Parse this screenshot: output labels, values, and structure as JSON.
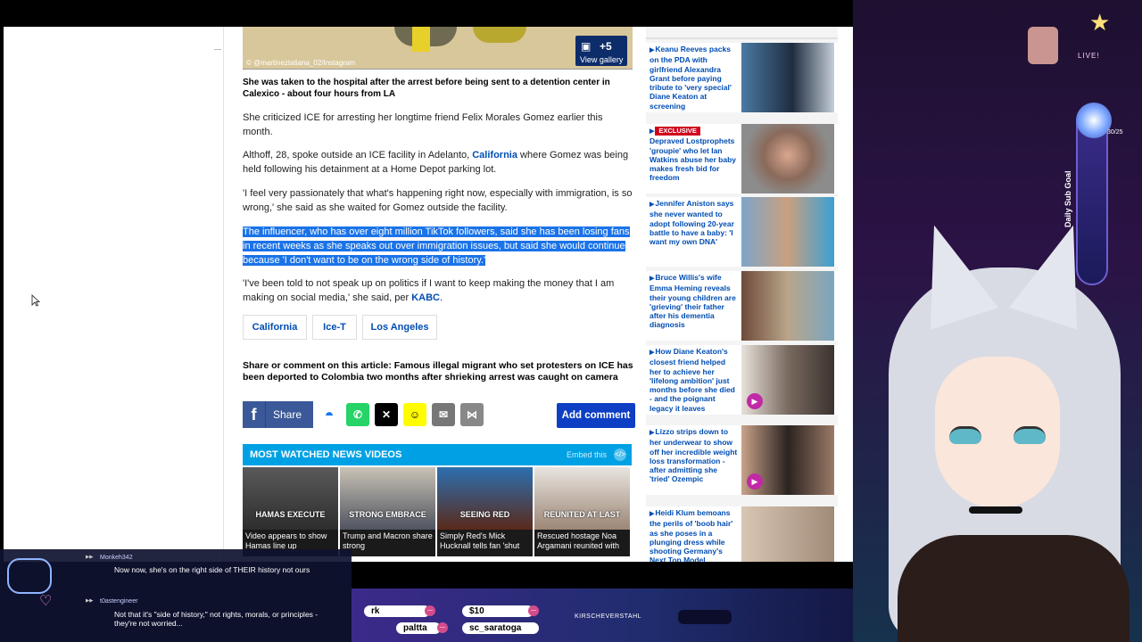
{
  "article": {
    "hero_credit": "© @martineztatiana_02/Instagram",
    "gallery_count": "+5",
    "gallery_label": "View gallery",
    "caption": "She was taken to the hospital after the arrest before being sent to a detention center in Calexico - about four hours from LA",
    "p1": "She criticized ICE for arresting her longtime friend Felix Morales Gomez earlier this month.",
    "p2_a": "Althoff, 28, spoke outside an ICE facility in Adelanto, ",
    "p2_link": "California",
    "p2_b": " where Gomez was being held following his detainment at a Home Depot parking lot.",
    "p3": "'I feel very passionately that what's happening right now, especially with immigration, is so wrong,' she said as she waited for Gomez outside the facility.",
    "p4_highlighted": "The influencer, who has over eight million TikTok followers, said she has been losing fans in recent weeks as she speaks out over immigration issues, but said she would continue because 'I don't want to be on the wrong side of history.'",
    "p5_a": "'I've been told to not speak up on politics if I want to keep making the money that I am making on social media,' she said, per ",
    "p5_link": "KABC",
    "p5_b": ".",
    "tags": [
      "California",
      "Ice-T",
      "Los Angeles"
    ],
    "share_title": "Share or comment on this article: Famous illegal migrant who set protesters on ICE has been deported to Colombia two months after shrieking arrest was caught on camera",
    "share_label": "Share",
    "add_comment": "Add comment",
    "videos": {
      "title": "MOST WATCHED NEWS VIDEOS",
      "embed": "Embed this",
      "items": [
        {
          "overlay": "HAMAS EXECUTE",
          "caption": "Video appears to show Hamas line up"
        },
        {
          "overlay": "STRONG EMBRACE",
          "caption": "Trump and Macron share strong"
        },
        {
          "overlay": "SEEING RED",
          "caption": "Simply Red's Mick Hucknall tells fan 'shut"
        },
        {
          "overlay": "REUNITED AT LAST",
          "caption": "Rescued hostage Noa Argamani reunited with"
        }
      ]
    }
  },
  "rail": {
    "items": [
      {
        "badge": "",
        "text": "Keanu Reeves packs on the PDA with girlfriend Alexandra Grant before paying tribute to 'very special' Diane Keaton at screening"
      },
      {
        "badge": "EXCLUSIVE",
        "text": "Depraved Lostprophets 'groupie' who let Ian Watkins abuse her baby makes fresh bid for freedom"
      },
      {
        "badge": "",
        "text": "Jennifer Aniston says she never wanted to adopt following 20-year battle to have a baby: 'I want my own DNA'"
      },
      {
        "badge": "",
        "text": "Bruce Willis's wife Emma Heming reveals their young children are 'grieving' their father after his dementia diagnosis"
      },
      {
        "badge": "",
        "text": "How Diane Keaton's closest friend helped her to achieve her 'lifelong ambition' just months before she died - and the poignant legacy it leaves"
      },
      {
        "badge": "",
        "text": "Lizzo strips down to her underwear to show off her incredible weight loss transformation - after admitting she 'tried' Ozempic"
      },
      {
        "badge": "",
        "text": "Heidi Klum bemoans the perils of 'boob hair' as she poses in a plunging dress while shooting Germany's Next Top Model"
      }
    ]
  },
  "stream": {
    "live": "LIVE!",
    "sub_goal": "Daily Sub Goal",
    "sub_count": "30/25",
    "chat": [
      {
        "user": "Monkeh342",
        "msg": "Now now, she's on the right side of THEIR history not ours"
      },
      {
        "user": "t0astengineer",
        "msg": "Not that it's \"side of history,\" not rights, morals, or principles - they're not worried..."
      }
    ],
    "alerts": {
      "a1": "rk",
      "a2": "$10",
      "a3": "paltta",
      "a4": "sc_saratoga",
      "a5": "KIRSCHEVERSTAHL"
    }
  }
}
